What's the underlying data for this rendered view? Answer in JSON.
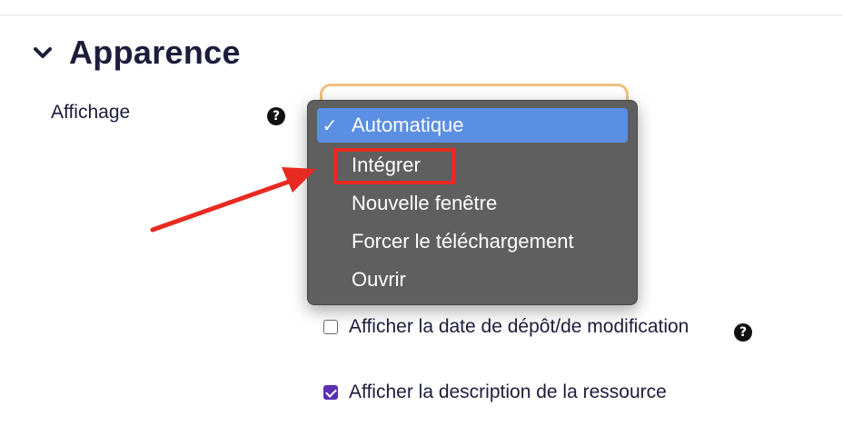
{
  "section": {
    "title": "Apparence",
    "toggle_icon": "chevron-down-icon"
  },
  "display_field": {
    "label": "Affichage",
    "help_icon": "question-circle-icon",
    "options": [
      {
        "label": "Automatique",
        "selected": true
      },
      {
        "label": "Intégrer",
        "selected": false,
        "highlighted": true
      },
      {
        "label": "Nouvelle fenêtre",
        "selected": false
      },
      {
        "label": "Forcer le téléchargement",
        "selected": false
      },
      {
        "label": "Ouvrir",
        "selected": false
      }
    ]
  },
  "checkboxes": [
    {
      "label": "Afficher la date de dépôt/de modification",
      "checked": false,
      "help_icon": "question-circle-icon"
    },
    {
      "label": "Afficher la description de la ressource",
      "checked": true
    }
  ],
  "colors": {
    "title": "#1d1d3b",
    "dropdown_bg": "#5f5f5f",
    "selected_option": "#5a8fe3",
    "highlight": "#e82a22",
    "checkbox_checked": "#5b2eb2",
    "select_border": "#f0c17a"
  }
}
